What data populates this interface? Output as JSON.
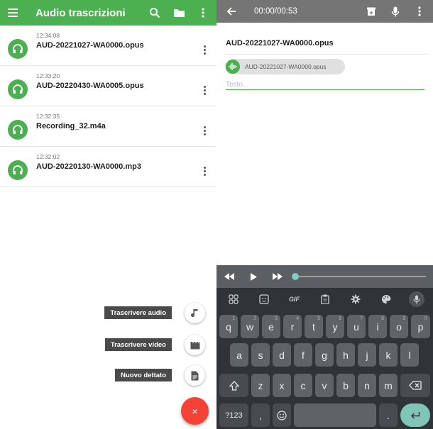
{
  "left": {
    "app_title": "Audio trascrizioni",
    "recordings": [
      {
        "time": "12:34:08",
        "name": "AUD-20221027-WA0000.opus"
      },
      {
        "time": "12:33:20",
        "name": "AUD-20220430-WA0005.opus"
      },
      {
        "time": "12:32:35",
        "name": "Recording_32.m4a"
      },
      {
        "time": "12:32:02",
        "name": "AUD-20220130-WA0000.mp3"
      }
    ],
    "fab_actions": {
      "audio": "Trascrivere audio",
      "video": "Trascrivere video",
      "dictation": "Nuovo dettato"
    },
    "fab_close": "×"
  },
  "right": {
    "player_time": "00:00/00:53",
    "doc_title": "AUD-20221027-WA0000.opus",
    "chip_label": "AUD-20221027-WA0000.opus",
    "text_placeholder": "Testo...",
    "audio_progress": 0.0
  },
  "keyboard": {
    "toolbar_gif": "GIF",
    "row1": [
      {
        "k": "q",
        "h": "1"
      },
      {
        "k": "w",
        "h": "2"
      },
      {
        "k": "e",
        "h": "3"
      },
      {
        "k": "r",
        "h": "4"
      },
      {
        "k": "t",
        "h": "5"
      },
      {
        "k": "y",
        "h": "6"
      },
      {
        "k": "u",
        "h": "7"
      },
      {
        "k": "i",
        "h": "8"
      },
      {
        "k": "o",
        "h": "9"
      },
      {
        "k": "p",
        "h": "0"
      }
    ],
    "row2": [
      "a",
      "s",
      "d",
      "f",
      "g",
      "h",
      "j",
      "k",
      "l"
    ],
    "row3": [
      "z",
      "x",
      "c",
      "v",
      "b",
      "n",
      "m"
    ],
    "symbols_key": "?123",
    "comma_key": ",",
    "period_key": "."
  },
  "colors": {
    "primary_green": "#4caf50",
    "player_bar": "#757575",
    "fab_red": "#f44336",
    "keyboard_bg": "#303436",
    "accent_teal": "#80cbc4"
  }
}
